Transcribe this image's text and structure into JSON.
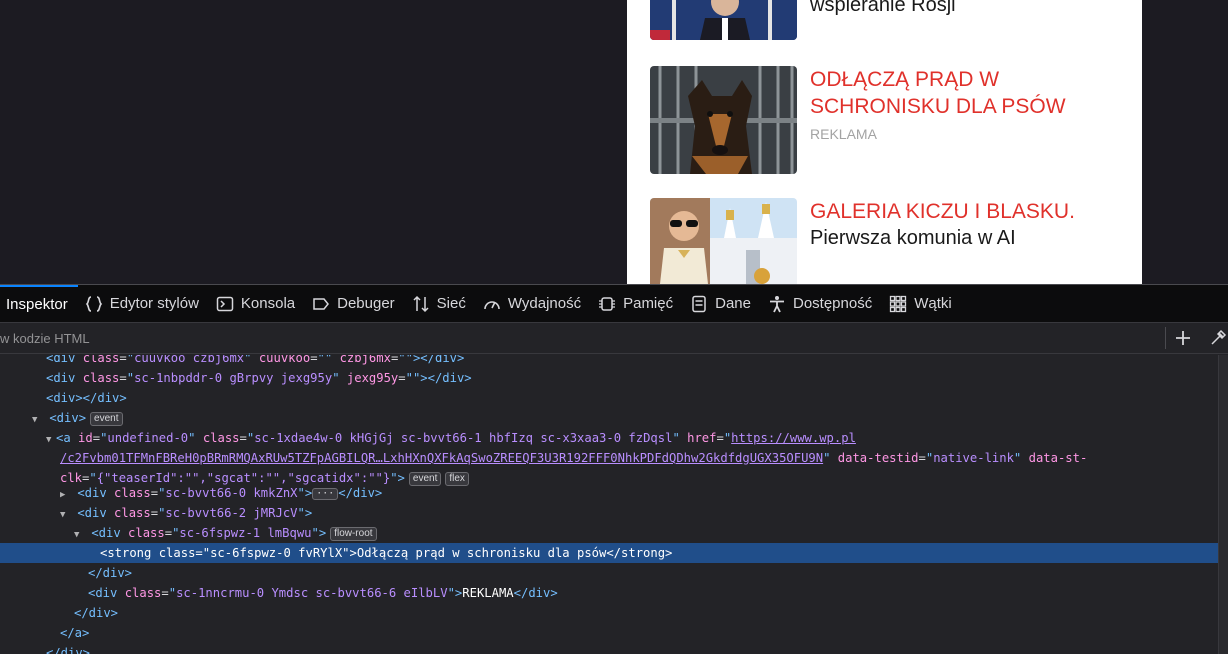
{
  "page": {
    "items": [
      {
        "title": "",
        "subtitle": "wspieranie Rosji",
        "ad": ""
      },
      {
        "title": "ODŁĄCZĄ PRĄD W SCHRONISKU DLA PSÓW",
        "subtitle": "",
        "ad": "REKLAMA"
      },
      {
        "title": "GALERIA KICZU I BLASKU.",
        "subtitle": "Pierwsza komunia w AI",
        "ad": ""
      }
    ]
  },
  "devtools": {
    "tabs": [
      {
        "label": "Inspektor",
        "icon": "inspector-icon"
      },
      {
        "label": "Edytor stylów",
        "icon": "braces-icon"
      },
      {
        "label": "Konsola",
        "icon": "console-icon"
      },
      {
        "label": "Debuger",
        "icon": "debugger-icon"
      },
      {
        "label": "Sieć",
        "icon": "network-icon"
      },
      {
        "label": "Wydajność",
        "icon": "gauge-icon"
      },
      {
        "label": "Pamięć",
        "icon": "memory-icon"
      },
      {
        "label": "Dane",
        "icon": "storage-icon"
      },
      {
        "label": "Dostępność",
        "icon": "accessibility-icon"
      },
      {
        "label": "Wątki",
        "icon": "grid-icon"
      }
    ],
    "search_placeholder": "w kodzie HTML",
    "tree": {
      "r0": {
        "tag": "div",
        "cls": "cuuvkoo czbj6mx",
        "a1": "cuuvkoo",
        "a2": "czbj6mx"
      },
      "r1": {
        "tag": "div",
        "cls": "sc-1nbpddr-0 gBrpvy jexg95y",
        "a1": "jexg95y"
      },
      "r4_class": "sc-1xdae4w-0 kHGjGj sc-bvvt66-1 hbfIzq sc-x3xaa3-0 fzDqsl",
      "r4_id": "undefined-0",
      "r4_href1": "https://www.wp.pl",
      "r4_href2": "/c2Fvbm01TFMnFBReH0pBRmRMQAxRUw5TZFpAGBILQR…LxhHXnQXFkAqSwoZREEQF3U3R192FFF0NhkPDFdQDhw2GkdfdgUGX35OFU9N",
      "r4_testid": "native-link",
      "r4_clk": "{\"teaserId\":\"\",\"sgcat\":\"\",\"sgcatidx\":\"\"}",
      "r6_class": "sc-bvvt66-0 kmkZnX",
      "r7_class": "sc-bvvt66-2 jMRJcV",
      "r8_class": "sc-6fspwz-1 lmBqwu",
      "r9_class": "sc-6fspwz-0 fvRYlX",
      "r9_text": "Odłączą prąd w schronisku dla psów",
      "r11_class": "sc-1nncrmu-0 Ymdsc sc-bvvt66-6 eIlbLV",
      "r11_text": "REKLAMA",
      "badge_event": "event",
      "badge_flex": "flex",
      "badge_flowroot": "flow-root"
    }
  }
}
